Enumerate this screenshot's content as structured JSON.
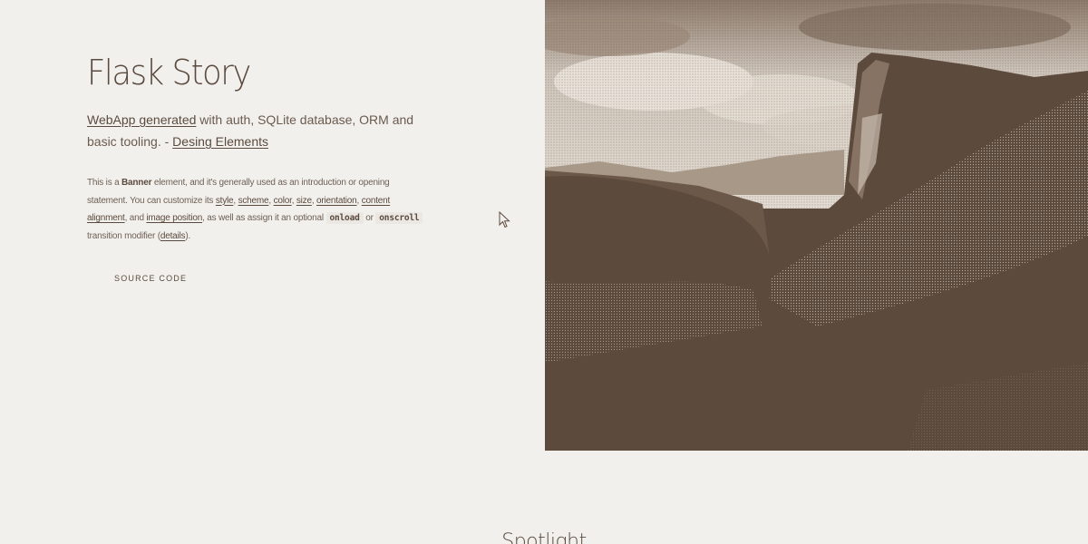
{
  "banner": {
    "title": "Flask Story",
    "major": {
      "link1": "WebApp generated",
      "text1": " with auth, SQLite database, ORM and basic tooling. - ",
      "link2": "Desing Elements"
    },
    "desc": {
      "t1": "This is a ",
      "strong": "Banner",
      "t2": " element, and it's generally used as an introduction or opening statement. You can customize its ",
      "l_style": "style",
      "sep1": ", ",
      "l_scheme": "scheme",
      "sep2": ", ",
      "l_color": "color",
      "sep3": ", ",
      "l_size": "size",
      "sep4": ", ",
      "l_orientation": "orientation",
      "sep5": ", ",
      "l_content": "content alignment",
      "t3": ", and ",
      "l_image": "image position",
      "t4": ", as well as assign it an optional ",
      "code1": "onload",
      "t5": " or ",
      "code2": "onscroll",
      "t6": " transition modifier (",
      "l_details": "details",
      "t7": ")."
    },
    "source_label": "Source Code"
  },
  "image": {
    "icon": "mountain-landscape-image",
    "colors": {
      "dark": "#5c4a3c",
      "sky": "#b8aca0",
      "light": "#f2f0ed"
    }
  },
  "next_section": {
    "title": "Spotlight"
  }
}
